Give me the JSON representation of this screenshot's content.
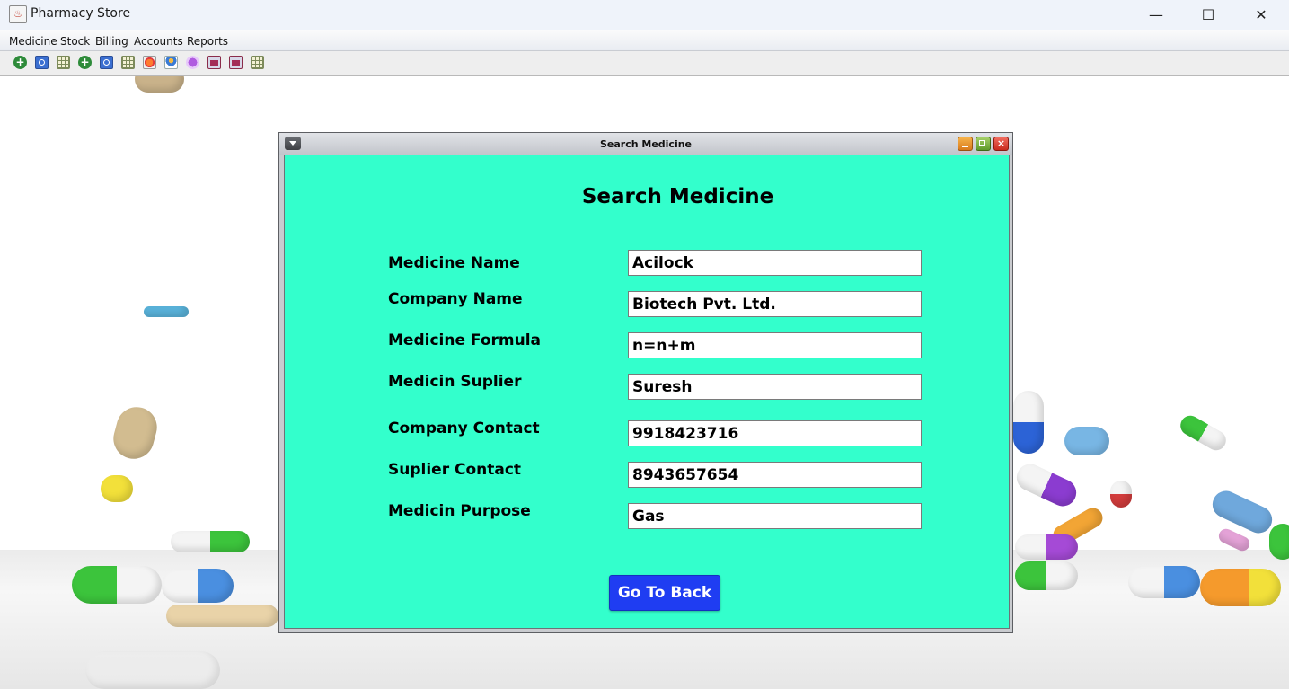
{
  "window": {
    "title": "Pharmacy Store",
    "minimize_symbol": "—",
    "maximize_symbol": "☐",
    "close_symbol": "✕"
  },
  "menubar": {
    "items": [
      "Medicine",
      "Stock",
      "Billing",
      "Accounts",
      "Reports"
    ]
  },
  "toolbar": {
    "icons": [
      "add-icon",
      "search-icon",
      "table-icon",
      "add-icon",
      "search-icon",
      "table-icon",
      "pie-chart-icon",
      "user-icon",
      "globe-icon",
      "report-icon",
      "report-icon",
      "table-icon"
    ]
  },
  "internal_frame": {
    "title": "Search Medicine",
    "heading": "Search Medicine",
    "fields": [
      {
        "label": "Medicine Name",
        "value": "Acilock"
      },
      {
        "label": "Company Name",
        "value": "Biotech Pvt. Ltd."
      },
      {
        "label": "Medicine Formula",
        "value": "n=n+m"
      },
      {
        "label": "Medicin Suplier",
        "value": "Suresh"
      },
      {
        "label": "Company Contact",
        "value": "9918423716"
      },
      {
        "label": "Suplier Contact",
        "value": "8943657654"
      },
      {
        "label": "Medicin Purpose",
        "value": "Gas"
      }
    ],
    "back_button": "Go To Back"
  },
  "colors": {
    "form_background": "#33ffcc",
    "button_background": "#1f3df2",
    "button_text": "#ffffff"
  }
}
